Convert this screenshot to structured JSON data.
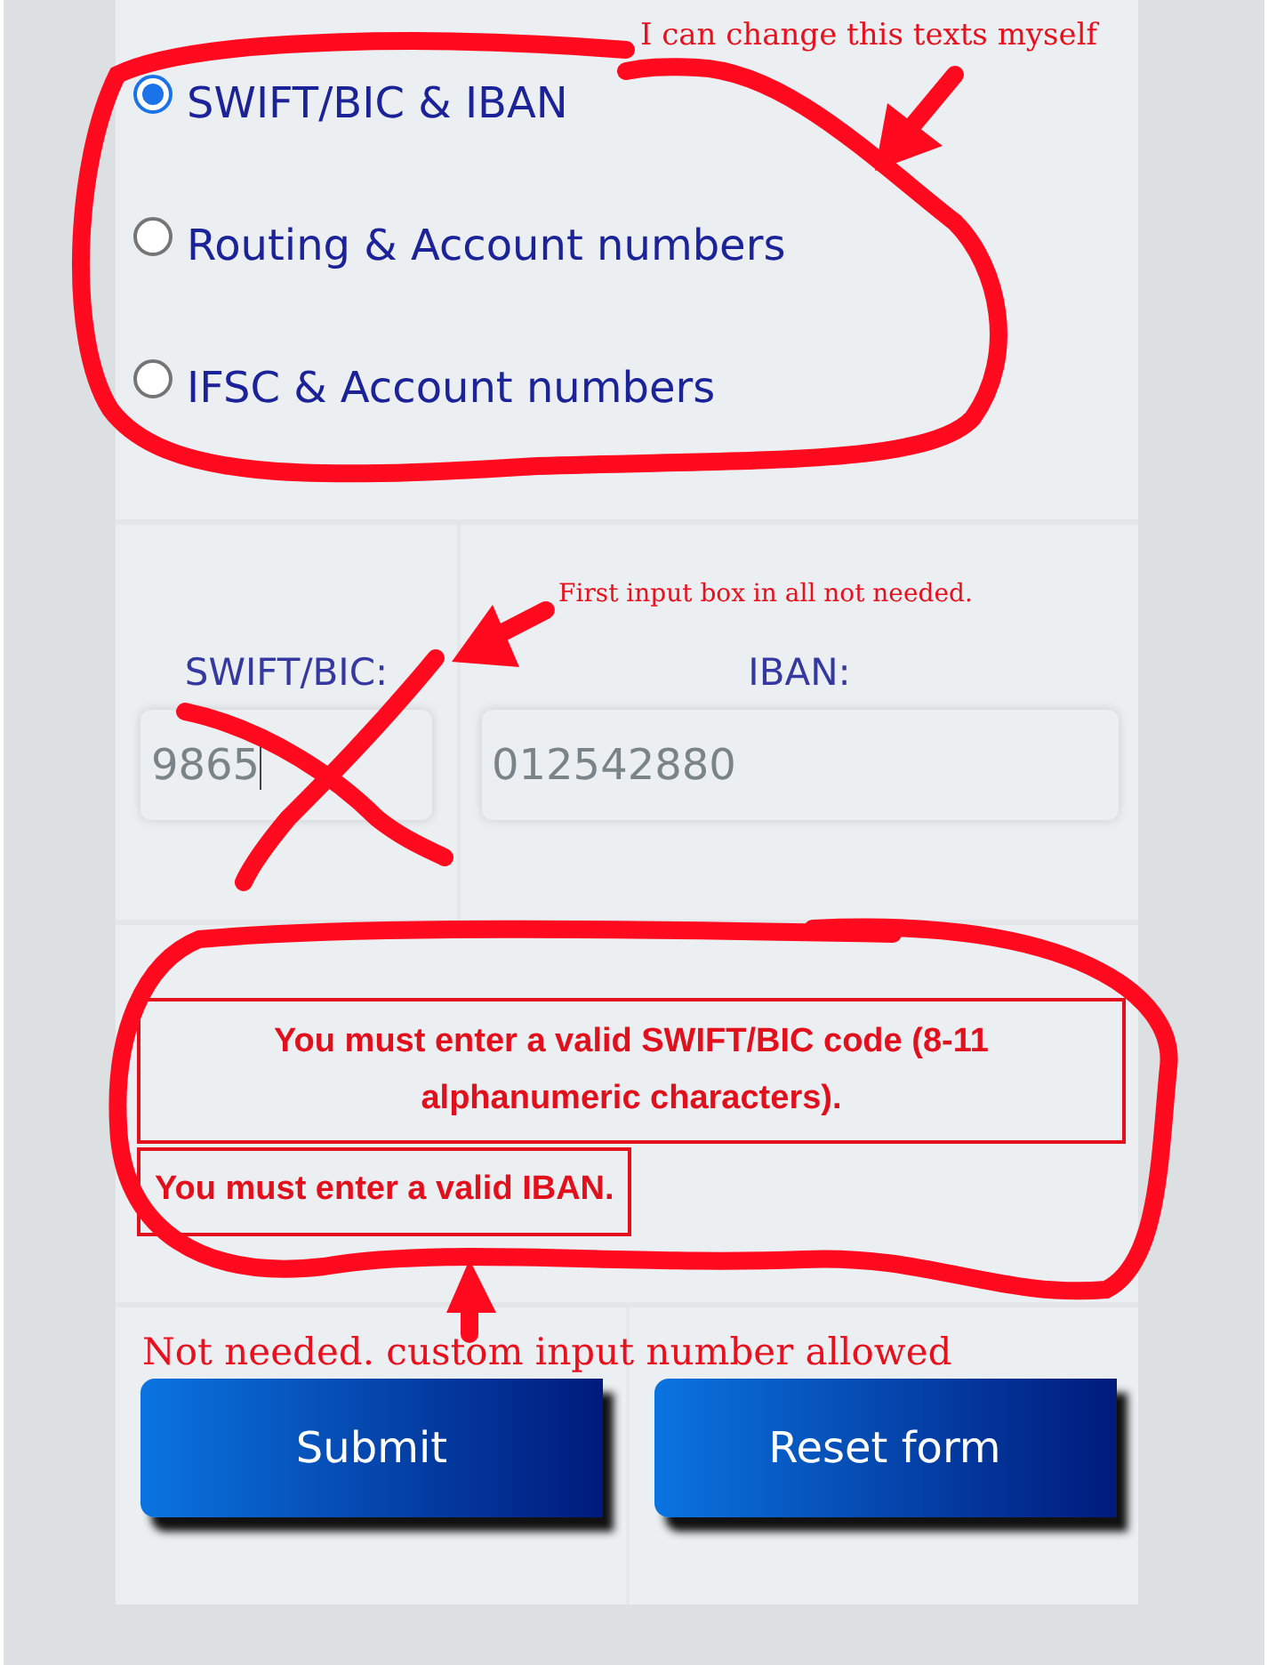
{
  "payment_method_options": [
    {
      "label": "SWIFT/BIC & IBAN",
      "selected": true
    },
    {
      "label": "Routing & Account numbers",
      "selected": false
    },
    {
      "label": "IFSC & Account numbers",
      "selected": false
    }
  ],
  "fields": [
    {
      "label": "SWIFT/BIC:",
      "value": "9865"
    },
    {
      "label": "IBAN:",
      "value": "012542880"
    }
  ],
  "errors": [
    "You must enter a valid SWIFT/BIC code (8-11 alphanumeric characters).",
    "You must enter a valid IBAN."
  ],
  "buttons": [
    "Submit",
    "Reset form"
  ],
  "annotations": [
    {
      "text": "I can change this texts myself"
    },
    {
      "text": "First input box in all not needed."
    },
    {
      "text": "Not needed. custom input number allowed"
    }
  ]
}
